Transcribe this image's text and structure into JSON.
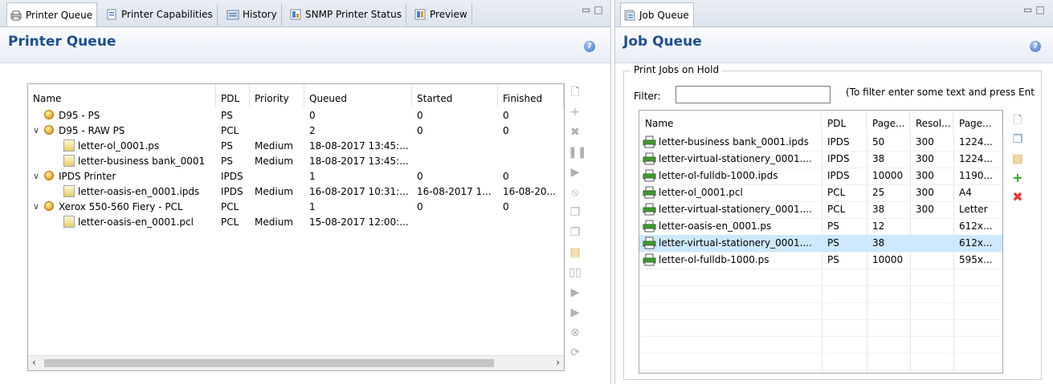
{
  "left": {
    "tabs": [
      {
        "label": "Printer Queue",
        "icon": "printer-queue-icon"
      },
      {
        "label": "Printer Capabilities",
        "icon": "capabilities-icon"
      },
      {
        "label": "History",
        "icon": "history-icon"
      },
      {
        "label": "SNMP Printer Status",
        "icon": "snmp-icon"
      },
      {
        "label": "Preview",
        "icon": "preview-icon"
      }
    ],
    "title": "Printer Queue",
    "columns": [
      "Name",
      "PDL",
      "Priority",
      "Queued",
      "Started",
      "Finished"
    ],
    "rows": [
      {
        "level": 0,
        "expanded": null,
        "icon": "printer",
        "name": "D95 - PS",
        "pdl": "PS",
        "priority": "",
        "queued": "0",
        "started": "0",
        "finished": "0"
      },
      {
        "level": 0,
        "expanded": true,
        "icon": "printer",
        "name": "D95 - RAW PS",
        "pdl": "PCL",
        "priority": "",
        "queued": "2",
        "started": "0",
        "finished": "0"
      },
      {
        "level": 1,
        "expanded": null,
        "icon": "doc",
        "name": "letter-ol_0001.ps",
        "pdl": "PS",
        "priority": "Medium",
        "queued": "18-08-2017 13:45:...",
        "started": "",
        "finished": ""
      },
      {
        "level": 1,
        "expanded": null,
        "icon": "doc",
        "name": "letter-business bank_0001",
        "pdl": "PS",
        "priority": "Medium",
        "queued": "18-08-2017 13:45:...",
        "started": "",
        "finished": ""
      },
      {
        "level": 0,
        "expanded": true,
        "icon": "printer",
        "name": "IPDS Printer",
        "pdl": "IPDS",
        "priority": "",
        "queued": "1",
        "started": "0",
        "finished": "0"
      },
      {
        "level": 1,
        "expanded": null,
        "icon": "doc",
        "name": "letter-oasis-en_0001.ipds",
        "pdl": "IPDS",
        "priority": "Medium",
        "queued": "16-08-2017 10:31:...",
        "started": "16-08-2017 1...",
        "finished": "16-08-20..."
      },
      {
        "level": 0,
        "expanded": true,
        "icon": "printer",
        "name": "Xerox 550-560 Fiery  - PCL",
        "pdl": "PCL",
        "priority": "",
        "queued": "1",
        "started": "0",
        "finished": "0"
      },
      {
        "level": 1,
        "expanded": null,
        "icon": "doc",
        "name": "letter-oasis-en_0001.pcl",
        "pdl": "PCL",
        "priority": "Medium",
        "queued": "15-08-2017 12:00:...",
        "started": "",
        "finished": ""
      }
    ],
    "scroll": {
      "left": "‹",
      "right": "›"
    },
    "toolbar": [
      "new-doc-icon",
      "add-icon",
      "delete-icon",
      "pause-icon",
      "play-icon",
      "cancel-icon",
      "copy-icon",
      "copy2-icon",
      "move-doc-icon",
      "pause2-icon",
      "resume-icon",
      "resume2-icon",
      "remove-doc-icon",
      "refresh-icon"
    ]
  },
  "right": {
    "tab": "Job Queue",
    "title": "Job Queue",
    "group": "Print Jobs on Hold",
    "filter_label": "Filter:",
    "filter_value": "",
    "filter_hint": "(To filter enter some text and press Ent",
    "columns": [
      "Name",
      "PDL",
      "Page...",
      "Resol...",
      "Page..."
    ],
    "rows": [
      {
        "name": "letter-business bank_0001.ipds",
        "pdl": "IPDS",
        "pages": "50",
        "res": "300",
        "size": "1224...",
        "selected": false
      },
      {
        "name": "letter-virtual-stationery_0001....",
        "pdl": "IPDS",
        "pages": "38",
        "res": "300",
        "size": "1224...",
        "selected": false
      },
      {
        "name": "letter-ol-fulldb-1000.ipds",
        "pdl": "IPDS",
        "pages": "10000",
        "res": "300",
        "size": "1190...",
        "selected": false
      },
      {
        "name": "letter-ol_0001.pcl",
        "pdl": "PCL",
        "pages": "25",
        "res": "300",
        "size": "A4",
        "selected": false
      },
      {
        "name": "letter-virtual-stationery_0001....",
        "pdl": "PCL",
        "pages": "38",
        "res": "300",
        "size": "Letter",
        "selected": false
      },
      {
        "name": "letter-oasis-en_0001.ps",
        "pdl": "PS",
        "pages": "12",
        "res": "",
        "size": "612x...",
        "selected": false
      },
      {
        "name": "letter-virtual-stationery_0001....",
        "pdl": "PS",
        "pages": "38",
        "res": "",
        "size": "612x...",
        "selected": true
      },
      {
        "name": "letter-ol-fulldb-1000.ps",
        "pdl": "PS",
        "pages": "10000",
        "res": "",
        "size": "595x...",
        "selected": false
      }
    ],
    "toolbar": [
      "new-doc-icon",
      "copy-icon",
      "properties-icon",
      "add-icon",
      "delete-icon"
    ]
  },
  "colors": {
    "accent": "#1f4e8c",
    "selection": "#cde8ff",
    "add": "#2ea52e",
    "delete": "#e23b3b"
  }
}
